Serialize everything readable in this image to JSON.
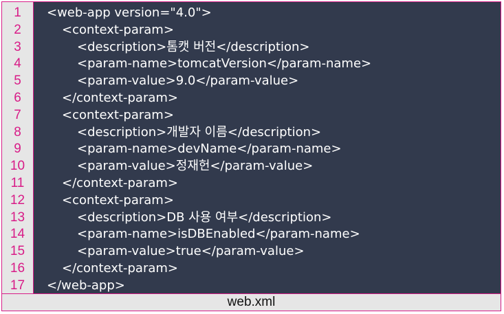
{
  "lines": [
    {
      "number": "1",
      "indent": 0,
      "text": "<web-app version=\"4.0\">"
    },
    {
      "number": "2",
      "indent": 1,
      "text": "<context-param>"
    },
    {
      "number": "3",
      "indent": 2,
      "text": "<description>톰캣 버전</description>"
    },
    {
      "number": "4",
      "indent": 2,
      "text": "<param-name>tomcatVersion</param-name>"
    },
    {
      "number": "5",
      "indent": 2,
      "text": "<param-value>9.0</param-value>"
    },
    {
      "number": "6",
      "indent": 1,
      "text": "</context-param>"
    },
    {
      "number": "7",
      "indent": 1,
      "text": "<context-param>"
    },
    {
      "number": "8",
      "indent": 2,
      "text": "<description>개발자 이름</description>"
    },
    {
      "number": "9",
      "indent": 2,
      "text": "<param-name>devName</param-name>"
    },
    {
      "number": "10",
      "indent": 2,
      "text": "<param-value>정재헌</param-value>"
    },
    {
      "number": "11",
      "indent": 1,
      "text": "</context-param>"
    },
    {
      "number": "12",
      "indent": 1,
      "text": "<context-param>"
    },
    {
      "number": "13",
      "indent": 2,
      "text": "<description>DB 사용 여부</description>"
    },
    {
      "number": "14",
      "indent": 2,
      "text": "<param-name>isDBEnabled</param-name>"
    },
    {
      "number": "15",
      "indent": 2,
      "text": "<param-value>true</param-value>"
    },
    {
      "number": "16",
      "indent": 1,
      "text": "</context-param>"
    },
    {
      "number": "17",
      "indent": 0,
      "text": "</web-app>"
    }
  ],
  "caption": "web.xml",
  "colors": {
    "editor_background": "#323a4d",
    "gutter_background": "#e6e6e6",
    "line_number": "#d81b87",
    "border": "#d81b87",
    "code_text": "#ffffff"
  }
}
